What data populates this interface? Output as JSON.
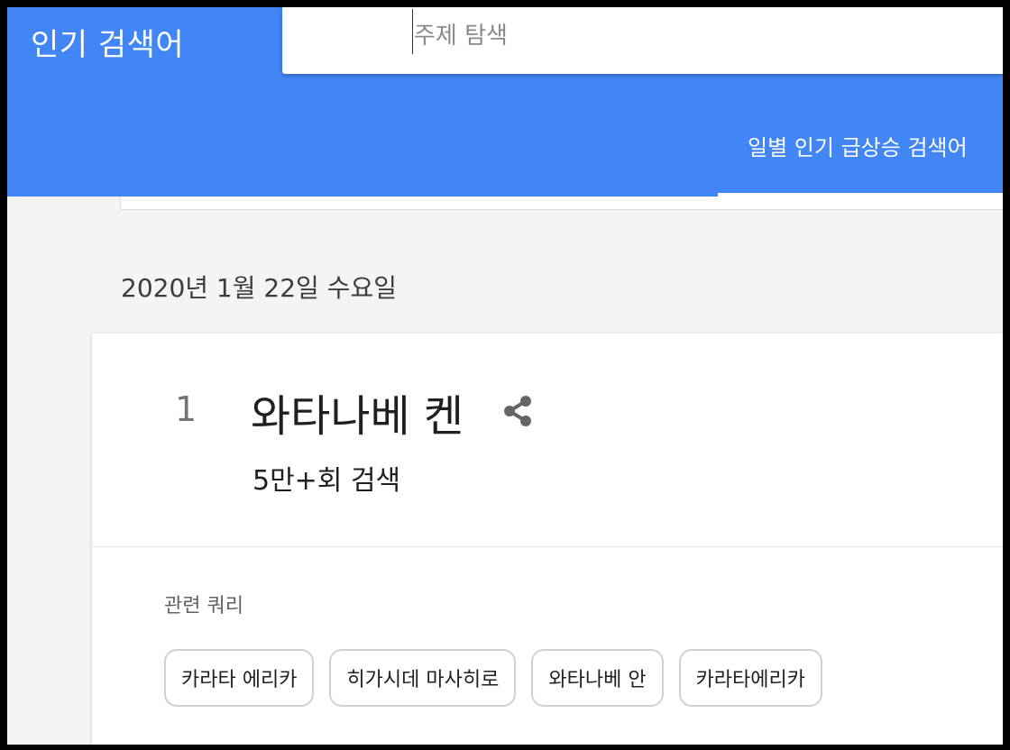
{
  "header": {
    "title": "인기 검색어",
    "search": {
      "placeholder": "주제 탐색",
      "value": ""
    },
    "tab": {
      "label": "일별 인기 급상승 검색어",
      "active": true
    }
  },
  "date_heading": "2020년 1월 22일 수요일",
  "trend": {
    "rank": "1",
    "title": "와타나베 켄",
    "search_count": "5만+회 검색",
    "share_icon": "share-icon",
    "related_label": "관련 쿼리",
    "related_queries": [
      "카라타 에리카",
      "히가시데 마사히로",
      "와타나베 안",
      "카라타에리카"
    ]
  },
  "colors": {
    "header_bg": "#4285f4",
    "page_bg": "#f4f4f4",
    "card_bg": "#ffffff",
    "chip_border": "#d0d0d0"
  }
}
